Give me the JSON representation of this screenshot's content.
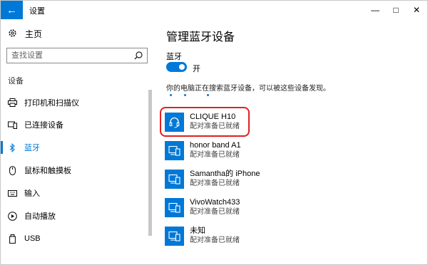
{
  "window": {
    "title": "设置",
    "back_glyph": "←",
    "minimize_glyph": "—",
    "maximize_glyph": "□",
    "close_glyph": "✕"
  },
  "nav": {
    "home_label": "主页",
    "search_placeholder": "查找设置",
    "section_title": "设备",
    "items": [
      {
        "label": "打印机和扫描仪",
        "icon": "printer-icon"
      },
      {
        "label": "已连接设备",
        "icon": "connected-devices-icon"
      },
      {
        "label": "蓝牙",
        "icon": "bluetooth-icon",
        "active": true
      },
      {
        "label": "鼠标和触摸板",
        "icon": "mouse-icon"
      },
      {
        "label": "输入",
        "icon": "keyboard-icon"
      },
      {
        "label": "自动播放",
        "icon": "autoplay-icon"
      },
      {
        "label": "USB",
        "icon": "usb-icon"
      }
    ]
  },
  "main": {
    "title": "管理蓝牙设备",
    "bluetooth_label": "蓝牙",
    "toggle_state": "开",
    "status_text": "你的电脑正在搜索蓝牙设备，可以被这些设备发现。",
    "devices": [
      {
        "name": "CLIQUE H10",
        "status": "配对准备已就绪",
        "icon": "headset-icon",
        "highlighted": true
      },
      {
        "name": "honor band A1",
        "status": "配对准备已就绪",
        "icon": "device-icon"
      },
      {
        "name": "Samantha的 iPhone",
        "status": "配对准备已就绪",
        "icon": "phone-icon"
      },
      {
        "name": "VivoWatch433",
        "status": "配对准备已就绪",
        "icon": "device-icon"
      },
      {
        "name": "未知",
        "status": "配对准备已就绪",
        "icon": "device-icon"
      }
    ]
  },
  "colors": {
    "accent": "#0078d7",
    "highlight_ring": "#e02020"
  }
}
